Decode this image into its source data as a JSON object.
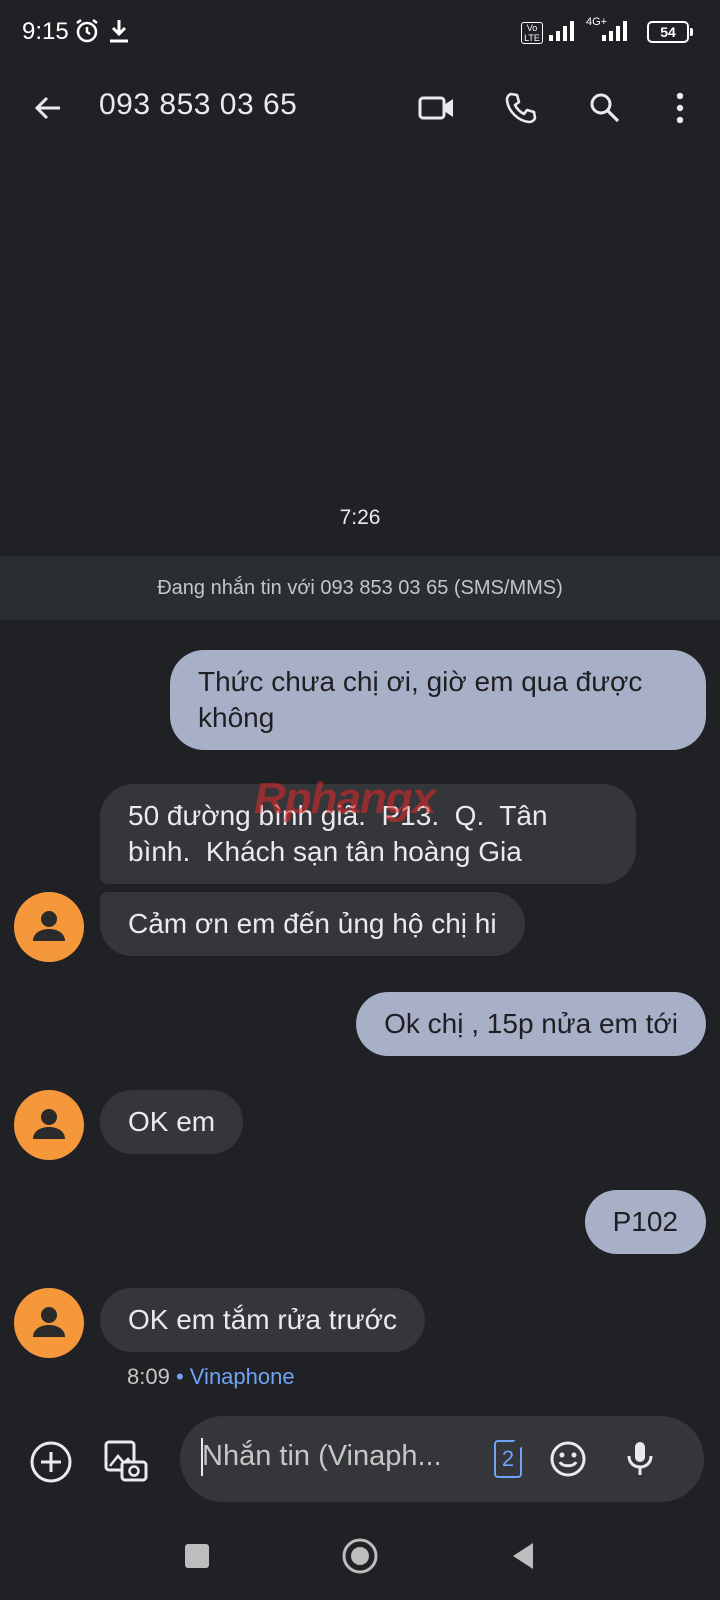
{
  "status_bar": {
    "time": "9:15",
    "network": "4G+",
    "volte": "Vo LTE",
    "battery": "54"
  },
  "app_bar": {
    "contact": "093 853 03 65"
  },
  "conversation": {
    "time_separator": "7:26",
    "info_banner": "Đang nhắn tin với 093 853 03 65 (SMS/MMS)",
    "messages": [
      {
        "direction": "outgoing",
        "text": "Thức chưa chị ơi, giờ em qua được\nkhông"
      },
      {
        "direction": "incoming",
        "text": "50 đường bình giã.  P13.  Q.  Tân\nbình.  Khách sạn tân hoàng Gia"
      },
      {
        "direction": "incoming",
        "text": "Cảm ơn em đến ủng hộ chị hi"
      },
      {
        "direction": "outgoing",
        "text": "Ok chị , 15p nửa em tới"
      },
      {
        "direction": "incoming",
        "text": "OK em"
      },
      {
        "direction": "outgoing",
        "text": "P102"
      },
      {
        "direction": "incoming",
        "text": "OK em tắm rửa trước"
      }
    ],
    "last_time": "8:09",
    "separator_dot": "•",
    "carrier": "Vinaphone",
    "watermark": "Rphangx"
  },
  "composer": {
    "placeholder": "Nhắn tin (Vinaph...",
    "sim_slot": "2"
  },
  "colors": {
    "background": "#202124",
    "outgoing_bubble": "#a8b0c8",
    "incoming_bubble": "#34363a",
    "avatar": "#f5983b",
    "accent": "#6fa3f6"
  }
}
